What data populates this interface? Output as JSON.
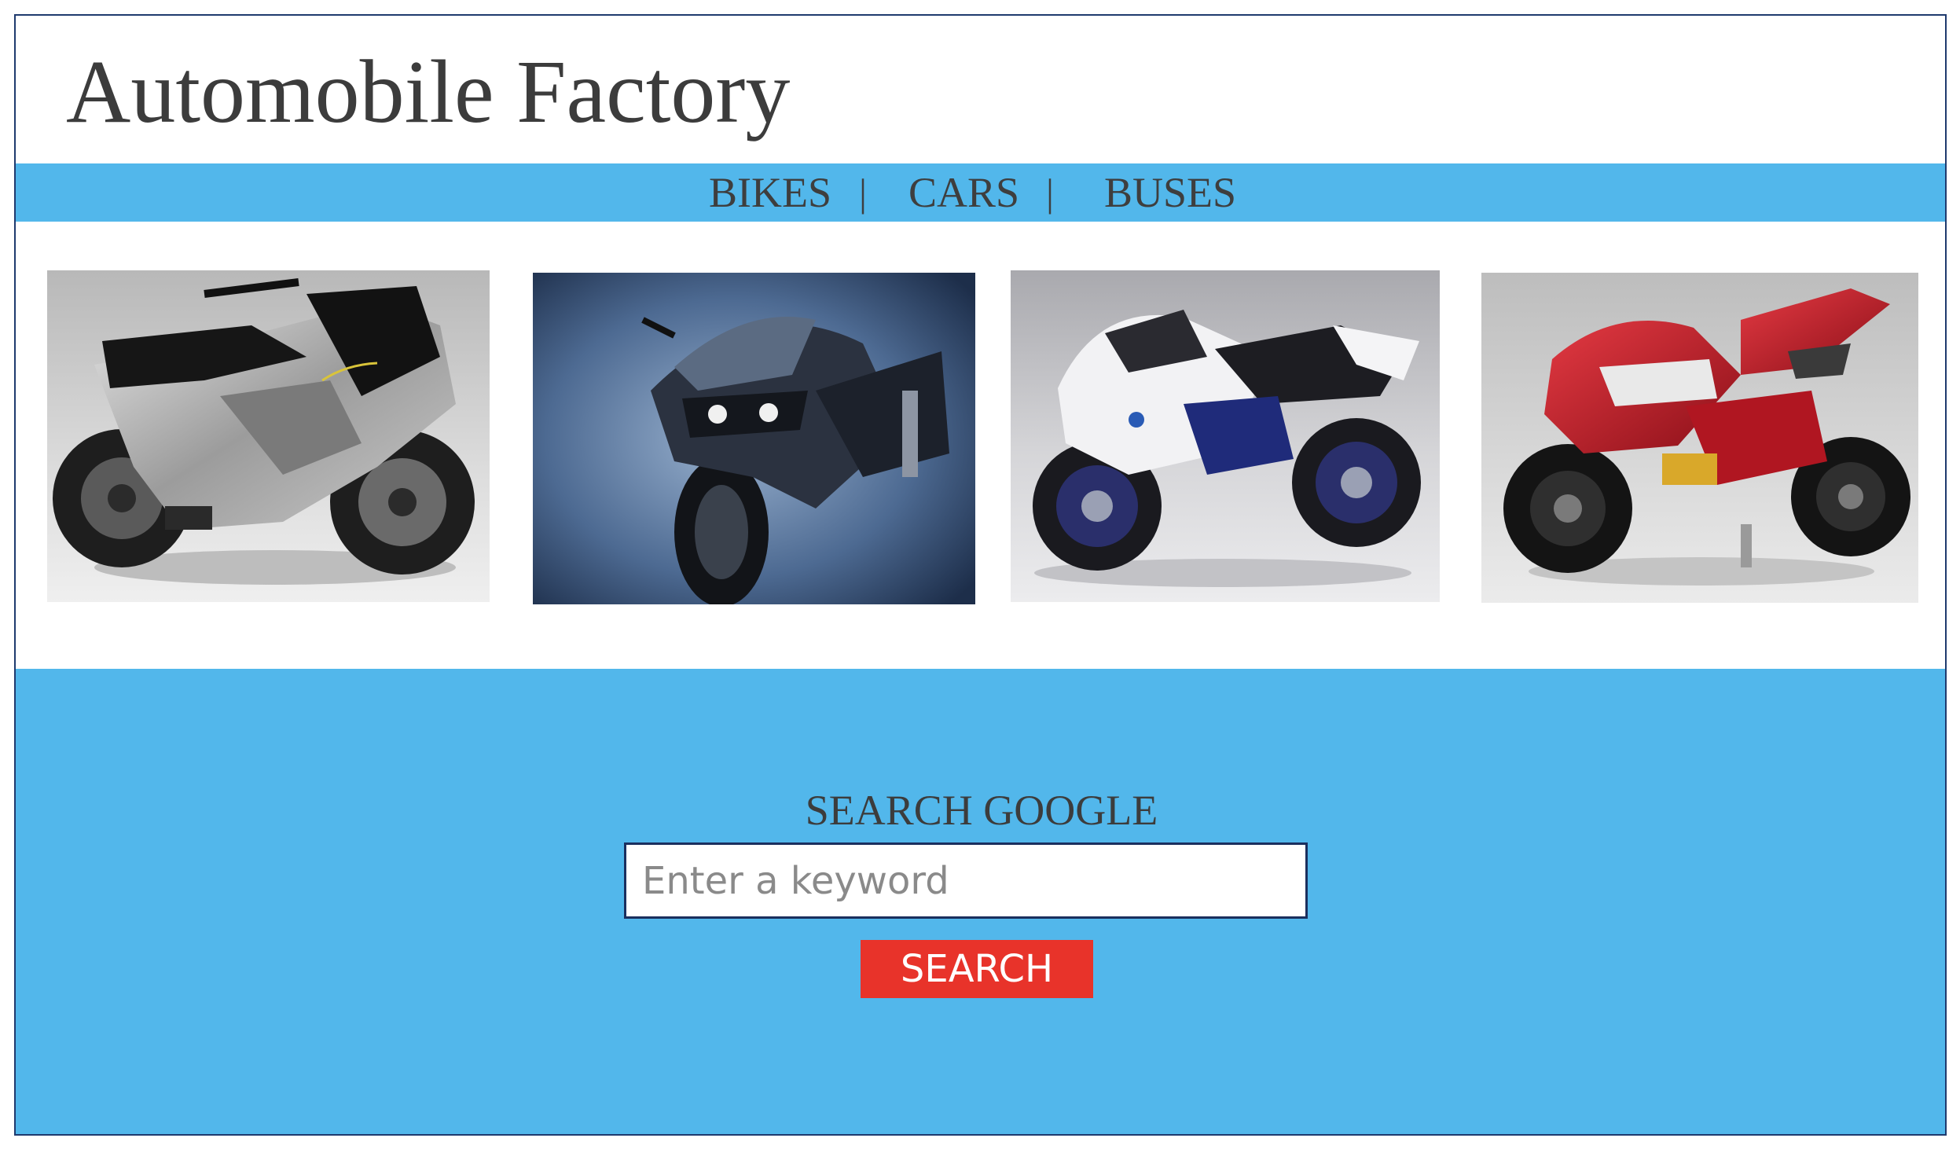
{
  "header": {
    "title": "Automobile Factory"
  },
  "nav": {
    "items": [
      {
        "label": "BIKES"
      },
      {
        "label": "CARS"
      },
      {
        "label": "BUSES"
      }
    ],
    "separator": "|"
  },
  "gallery": {
    "images": [
      {
        "subject": "silver concept motorcycle"
      },
      {
        "subject": "dark blue sport touring motorcycle"
      },
      {
        "subject": "white and blue sport motorcycle"
      },
      {
        "subject": "red and silver sport motorcycle"
      }
    ]
  },
  "search": {
    "heading": "SEARCH GOOGLE",
    "placeholder": "Enter a keyword",
    "value": "",
    "button_label": "SEARCH"
  },
  "colors": {
    "accent_blue": "#52b7eb",
    "button_red": "#e8332a",
    "frame_border": "#1f3a6e",
    "text_dark": "#3c3c3c"
  }
}
